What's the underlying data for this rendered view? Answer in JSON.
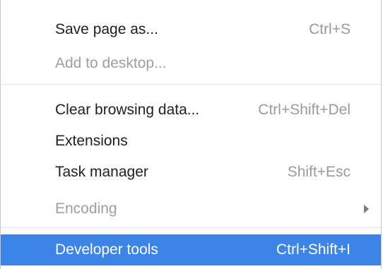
{
  "menu": {
    "items": [
      {
        "label": "Save page as...",
        "shortcut": "Ctrl+S",
        "enabled": true
      },
      {
        "label": "Add to desktop...",
        "shortcut": "",
        "enabled": false
      },
      {
        "label": "Clear browsing data...",
        "shortcut": "Ctrl+Shift+Del",
        "enabled": true
      },
      {
        "label": "Extensions",
        "shortcut": "",
        "enabled": true
      },
      {
        "label": "Task manager",
        "shortcut": "Shift+Esc",
        "enabled": true
      },
      {
        "label": "Encoding",
        "shortcut": "",
        "enabled": false,
        "submenu_icon": "chevron-right-icon"
      },
      {
        "label": "Developer tools",
        "shortcut": "Ctrl+Shift+I",
        "enabled": true,
        "highlighted": true
      }
    ]
  },
  "colors": {
    "highlight": "#3c84e6",
    "text": "#202020",
    "disabled_text": "#9e9e9e",
    "shortcut_text": "#9a9a9a",
    "separator": "#e3e3e3"
  }
}
